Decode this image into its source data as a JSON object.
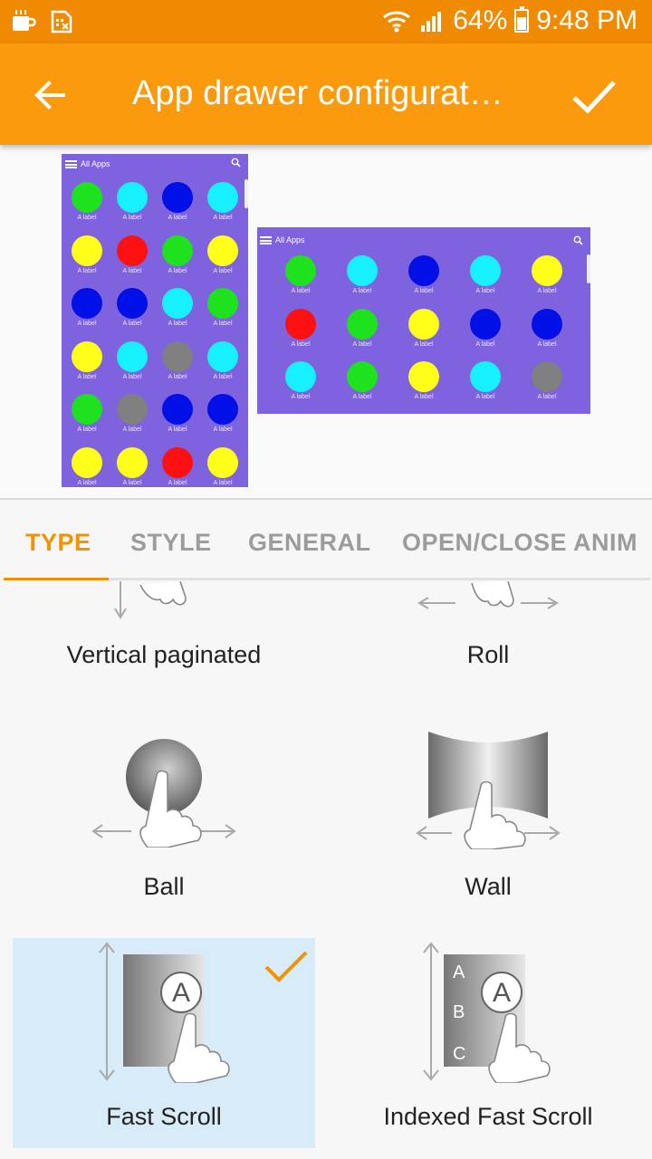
{
  "status_bar": {
    "battery": "64%",
    "time": "9:48 PM",
    "left_icons": [
      "coffee-notification-icon",
      "sim-card-icon"
    ]
  },
  "app_bar": {
    "title": "App drawer configurat…",
    "back_icon": "arrow-back-icon",
    "confirm_icon": "checkmark-icon"
  },
  "preview": {
    "portrait": {
      "header": "All Apps",
      "app_label": "A label",
      "rows": [
        [
          "#1ee21e",
          "#17f0ff",
          "#0010e6",
          "#17f0ff"
        ],
        [
          "#ffff1a",
          "#ff1010",
          "#1ee21e",
          "#ffff1a"
        ],
        [
          "#0010e6",
          "#0010e6",
          "#17f0ff",
          "#1ee21e"
        ],
        [
          "#ffff1a",
          "#17f0ff",
          "#808080",
          "#17f0ff"
        ],
        [
          "#1ee21e",
          "#808080",
          "#0010e6",
          "#0010e6"
        ],
        [
          "#ffff1a",
          "#ffff1a",
          "#ff1010",
          "#ffff1a"
        ]
      ]
    },
    "landscape": {
      "header": "All Apps",
      "app_label": "A label",
      "rows": [
        [
          "#1ee21e",
          "#17f0ff",
          "#0010e6",
          "#17f0ff",
          "#ffff1a"
        ],
        [
          "#ff1010",
          "#1ee21e",
          "#ffff1a",
          "#0010e6",
          "#0010e6"
        ],
        [
          "#17f0ff",
          "#1ee21e",
          "#ffff1a",
          "#17f0ff",
          "#808080"
        ]
      ]
    }
  },
  "tabs": [
    {
      "label": "TYPE",
      "active": true
    },
    {
      "label": "STYLE",
      "active": false
    },
    {
      "label": "GENERAL",
      "active": false
    },
    {
      "label": "OPEN/CLOSE ANIM",
      "active": false
    }
  ],
  "types": [
    {
      "label": "Vertical paginated",
      "icon": "vertical-swipe-gesture-icon",
      "selected": false
    },
    {
      "label": "Roll",
      "icon": "horizontal-swipe-gesture-icon",
      "selected": false
    },
    {
      "label": "Ball",
      "icon": "ball-gesture-icon",
      "selected": false
    },
    {
      "label": "Wall",
      "icon": "wall-gesture-icon",
      "selected": false
    },
    {
      "label": "Fast Scroll",
      "icon": "fast-scroll-icon",
      "selected": true
    },
    {
      "label": "Indexed Fast Scroll",
      "icon": "indexed-fast-scroll-icon",
      "selected": false,
      "index_letters": [
        "A",
        "B",
        "C"
      ]
    }
  ],
  "colors": {
    "status_bar": "#f08a00",
    "app_bar": "#fb9a0c",
    "accent": "#f39200",
    "preview_bg": "#7e62de",
    "selected_bg": "#d7ebf8"
  }
}
